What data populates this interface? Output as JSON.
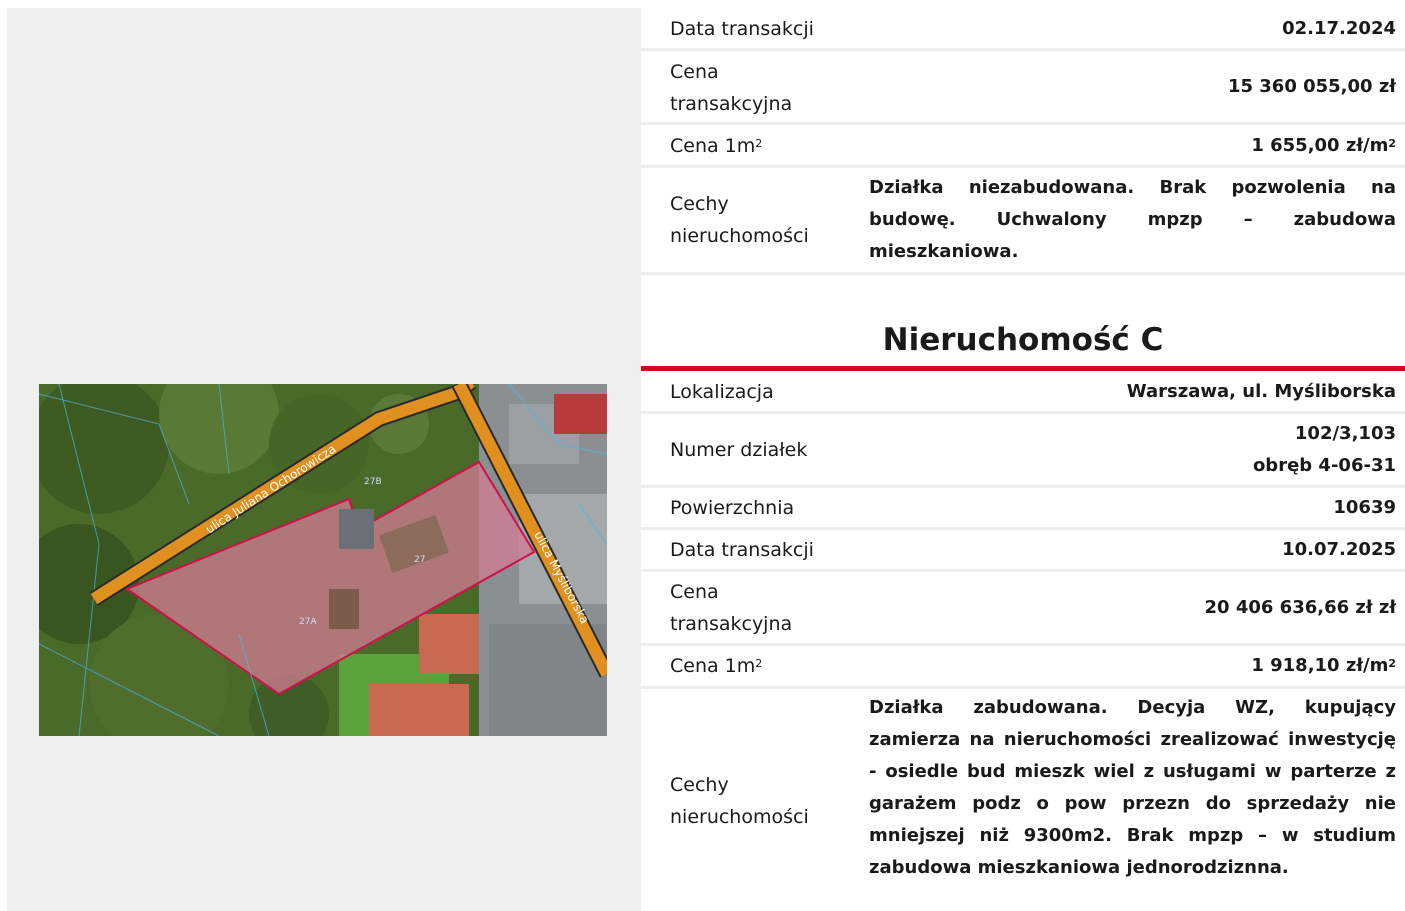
{
  "property_b": {
    "date_label": "Data transakcji",
    "date_value": "02.17.2024",
    "price_label_1": "Cena",
    "price_label_2": "transakcyjna",
    "price_value": "15 360 055,00 zł",
    "unit_label": "Cena 1m",
    "unit_sup": "2",
    "unit_value": "1 655,00 zł/m",
    "unit_value_sup": "2",
    "features_label_1": "Cechy",
    "features_label_2": "nieruchomości",
    "features_value": "Działka niezabudowana. Brak pozwolenia na budowę. Uchwalony mpzp – zabudowa mieszkaniowa."
  },
  "property_c": {
    "title": "Nieruchomość C",
    "location_label": "Lokalizacja",
    "location_value": "Warszawa, ul. Myśliborska",
    "plots_label": "Numer działek",
    "plots_value_1": "102/3,103",
    "plots_value_2": "obręb 4-06-31",
    "area_label": "Powierzchnia",
    "area_value": "10639",
    "date_label": "Data transakcji",
    "date_value": "10.07.2025",
    "price_label_1": "Cena",
    "price_label_2": "transakcyjna",
    "price_value": "20 406 636,66 zł zł",
    "unit_label": "Cena 1m",
    "unit_sup": "2",
    "unit_value": "1 918,10 zł/m",
    "unit_value_sup": "2",
    "features_label_1": "Cechy",
    "features_label_2": "nieruchomości",
    "features_value": "Działka zabudowana. Decyja WZ, kupujący zamierza na nieruchomości zrealizować inwestycję - osiedle bud mieszk wiel z usługami w parterze z garażem podz o pow przezn do sprzedaży nie mniejszej niż 9300m2. Brak mpzp – w studium zabudowa mieszkaniowa jednorodziznna."
  },
  "map": {
    "street_1": "ulica Juliana Ochorowicza",
    "street_2": "ulica Myśliborska",
    "marker_1": "27B",
    "marker_2": "27",
    "marker_3": "27A",
    "colors": {
      "road": "#e0901f",
      "plot_outline": "#d0104c",
      "plot_fill": "#e6789a",
      "accent": "#c4121c"
    }
  }
}
